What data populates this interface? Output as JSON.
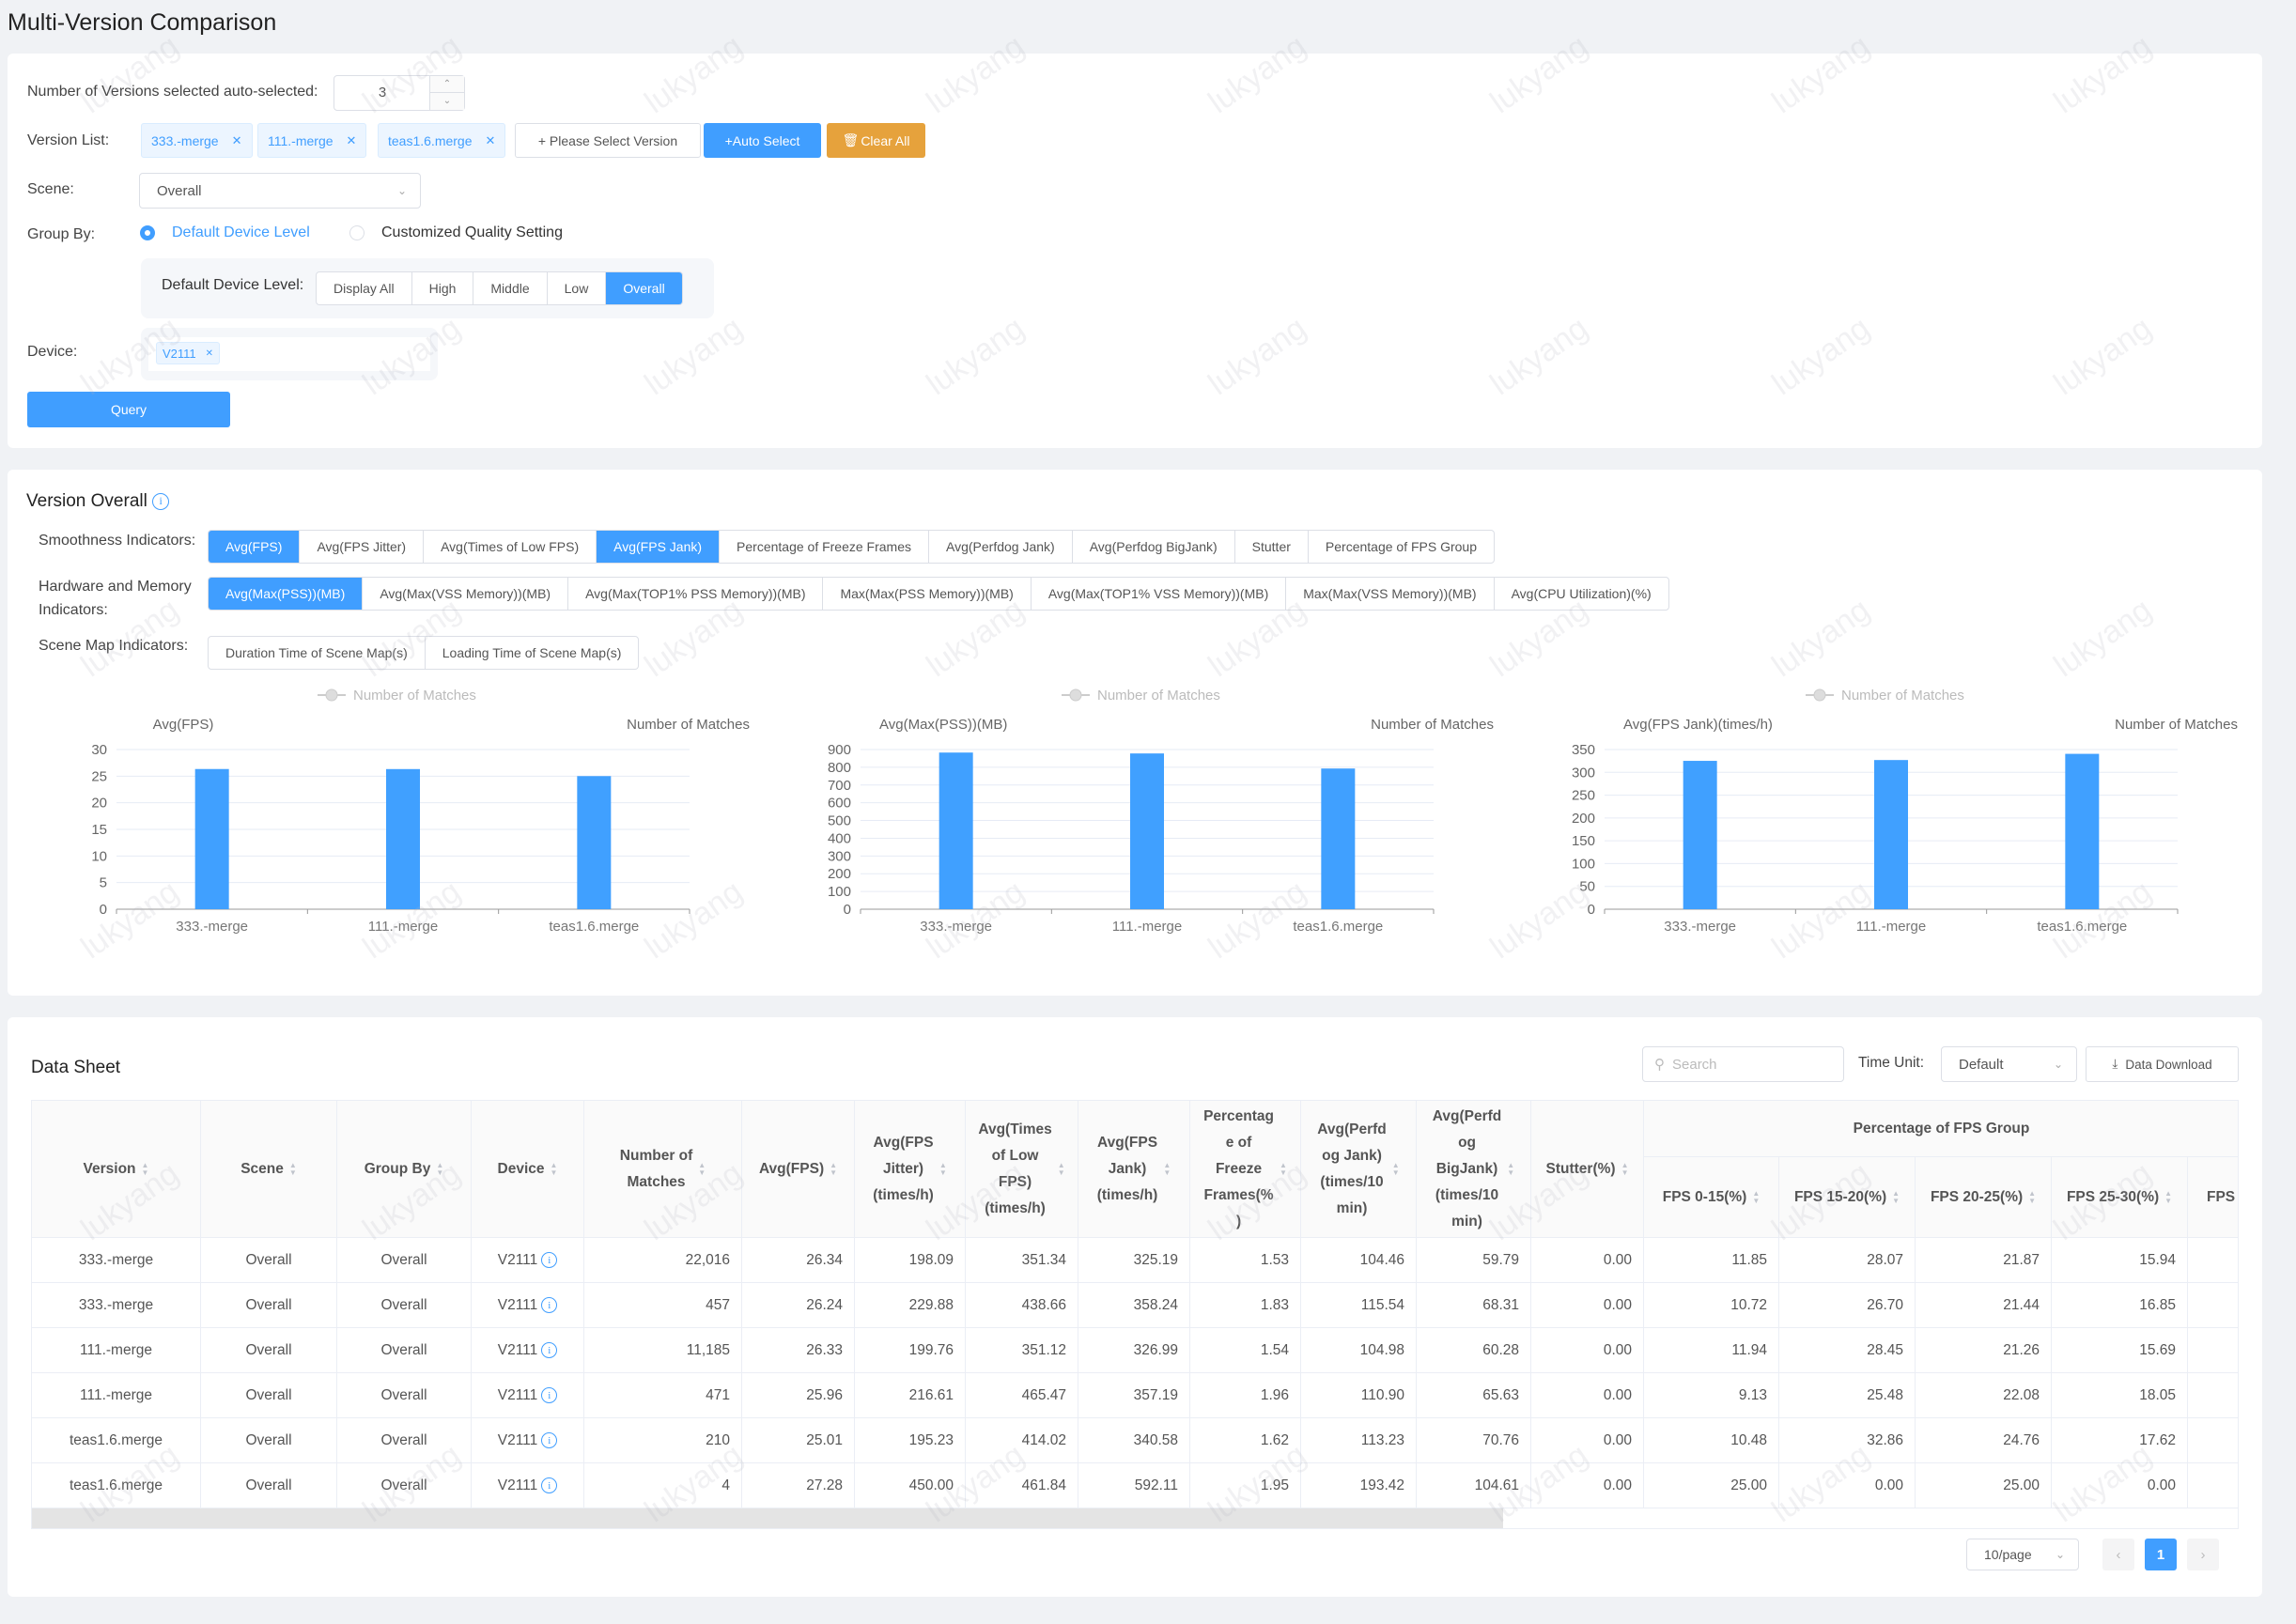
{
  "page": {
    "title": "Multi-Version Comparison"
  },
  "filters": {
    "num_versions_label": "Number of Versions selected auto-selected:",
    "num_versions_value": "3",
    "version_list_label": "Version List:",
    "versions": [
      "333.-merge",
      "111.-merge",
      "teas1.6.merge"
    ],
    "select_version_label": "+ Please Select Version",
    "auto_select_label": "+Auto Select",
    "clear_all_label": "Clear All",
    "scene_label": "Scene:",
    "scene_value": "Overall",
    "group_by_label": "Group By:",
    "group_by_options": [
      {
        "label": "Default Device Level",
        "selected": true
      },
      {
        "label": "Customized Quality Setting",
        "selected": false
      }
    ],
    "device_level_label": "Default Device Level:",
    "device_levels": [
      {
        "label": "Display All",
        "selected": false
      },
      {
        "label": "High",
        "selected": false
      },
      {
        "label": "Middle",
        "selected": false
      },
      {
        "label": "Low",
        "selected": false
      },
      {
        "label": "Overall",
        "selected": true
      }
    ],
    "device_label": "Device:",
    "devices": [
      "V2111"
    ],
    "query_label": "Query"
  },
  "overview": {
    "title": "Version Overall",
    "smoothness_label": "Smoothness Indicators:",
    "smoothness": [
      {
        "label": "Avg(FPS)",
        "selected": true
      },
      {
        "label": "Avg(FPS Jitter)",
        "selected": false
      },
      {
        "label": "Avg(Times of Low FPS)",
        "selected": false
      },
      {
        "label": "Avg(FPS Jank)",
        "selected": true
      },
      {
        "label": "Percentage of Freeze Frames",
        "selected": false
      },
      {
        "label": "Avg(Perfdog Jank)",
        "selected": false
      },
      {
        "label": "Avg(Perfdog BigJank)",
        "selected": false
      },
      {
        "label": "Stutter",
        "selected": false
      },
      {
        "label": "Percentage of FPS Group",
        "selected": false
      }
    ],
    "hardware_label_1": "Hardware and Memory",
    "hardware_label_2": "Indicators:",
    "hardware": [
      {
        "label": "Avg(Max(PSS))(MB)",
        "selected": true
      },
      {
        "label": "Avg(Max(VSS Memory))(MB)",
        "selected": false
      },
      {
        "label": "Avg(Max(TOP1% PSS Memory))(MB)",
        "selected": false
      },
      {
        "label": "Max(Max(PSS Memory))(MB)",
        "selected": false
      },
      {
        "label": "Avg(Max(TOP1% VSS Memory))(MB)",
        "selected": false
      },
      {
        "label": "Max(Max(VSS Memory))(MB)",
        "selected": false
      },
      {
        "label": "Avg(CPU Utilization)(%)",
        "selected": false
      }
    ],
    "scene_map_label": "Scene Map Indicators:",
    "scene_map": [
      {
        "label": "Duration Time of Scene Map(s)",
        "selected": false
      },
      {
        "label": "Loading Time of Scene Map(s)",
        "selected": false
      }
    ]
  },
  "chart_data": [
    {
      "type": "bar",
      "title": "",
      "legend": "Number of Matches",
      "legend_position": "top",
      "ylabel": "Avg(FPS)",
      "y2label": "Number of Matches",
      "categories": [
        "333.-merge",
        "111.-merge",
        "teas1.6.merge"
      ],
      "values": [
        26.34,
        26.33,
        25.01
      ],
      "ylim": [
        0,
        30
      ],
      "yticks": [
        0,
        5,
        10,
        15,
        20,
        25,
        30
      ],
      "grid": true
    },
    {
      "type": "bar",
      "title": "",
      "legend": "Number of Matches",
      "legend_position": "top",
      "ylabel": "Avg(Max(PSS))(MB)",
      "y2label": "Number of Matches",
      "categories": [
        "333.-merge",
        "111.-merge",
        "teas1.6.merge"
      ],
      "values": [
        883,
        878,
        793
      ],
      "ylim": [
        0,
        900
      ],
      "yticks": [
        0,
        100,
        200,
        300,
        400,
        500,
        600,
        700,
        800,
        900
      ],
      "grid": true
    },
    {
      "type": "bar",
      "title": "",
      "legend": "Number of Matches",
      "legend_position": "top",
      "ylabel": "Avg(FPS Jank)(times/h)",
      "y2label": "Number of Matches",
      "categories": [
        "333.-merge",
        "111.-merge",
        "teas1.6.merge"
      ],
      "values": [
        325.19,
        326.99,
        340.58
      ],
      "ylim": [
        0,
        350
      ],
      "yticks": [
        0,
        50,
        100,
        150,
        200,
        250,
        300,
        350
      ],
      "grid": true
    }
  ],
  "sheet": {
    "title": "Data Sheet",
    "search_placeholder": "Search",
    "time_unit_label": "Time Unit:",
    "time_unit_value": "Default",
    "download_label": "Data Download",
    "group_header": "Percentage of FPS Group",
    "columns": [
      "Version",
      "Scene",
      "Group By",
      "Device",
      "Number of Matches",
      "Avg(FPS)",
      "Avg(FPS Jitter)(times/h)",
      "Avg(Times of Low FPS)(times/h)",
      "Avg(FPS Jank)(times/h)",
      "Percentage of Freeze Frames(%)",
      "Avg(Perfdog Jank)(times/10 min)",
      "Avg(Perfdog BigJank)(times/10 min)",
      "Stutter(%)",
      "FPS 0-15(%)",
      "FPS 15-20(%)",
      "FPS 20-25(%)",
      "FPS 25-30(%)",
      "FPS"
    ],
    "rows": [
      [
        "333.-merge",
        "Overall",
        "Overall",
        "V2111",
        "22,016",
        "26.34",
        "198.09",
        "351.34",
        "325.19",
        "1.53",
        "104.46",
        "59.79",
        "0.00",
        "11.85",
        "28.07",
        "21.87",
        "15.94"
      ],
      [
        "333.-merge",
        "Overall",
        "Overall",
        "V2111",
        "457",
        "26.24",
        "229.88",
        "438.66",
        "358.24",
        "1.83",
        "115.54",
        "68.31",
        "0.00",
        "10.72",
        "26.70",
        "21.44",
        "16.85"
      ],
      [
        "111.-merge",
        "Overall",
        "Overall",
        "V2111",
        "11,185",
        "26.33",
        "199.76",
        "351.12",
        "326.99",
        "1.54",
        "104.98",
        "60.28",
        "0.00",
        "11.94",
        "28.45",
        "21.26",
        "15.69"
      ],
      [
        "111.-merge",
        "Overall",
        "Overall",
        "V2111",
        "471",
        "25.96",
        "216.61",
        "465.47",
        "357.19",
        "1.96",
        "110.90",
        "65.63",
        "0.00",
        "9.13",
        "25.48",
        "22.08",
        "18.05"
      ],
      [
        "teas1.6.merge",
        "Overall",
        "Overall",
        "V2111",
        "210",
        "25.01",
        "195.23",
        "414.02",
        "340.58",
        "1.62",
        "113.23",
        "70.76",
        "0.00",
        "10.48",
        "32.86",
        "24.76",
        "17.62"
      ],
      [
        "teas1.6.merge",
        "Overall",
        "Overall",
        "V2111",
        "4",
        "27.28",
        "450.00",
        "461.84",
        "592.11",
        "1.95",
        "193.42",
        "104.61",
        "0.00",
        "25.00",
        "0.00",
        "25.00",
        "0.00"
      ]
    ],
    "page_size": "10/page",
    "current_page": "1"
  },
  "watermark": "lukyang",
  "colors": {
    "primary": "#409eff",
    "warning": "#e6a23c",
    "bar": "#40a0ff"
  }
}
